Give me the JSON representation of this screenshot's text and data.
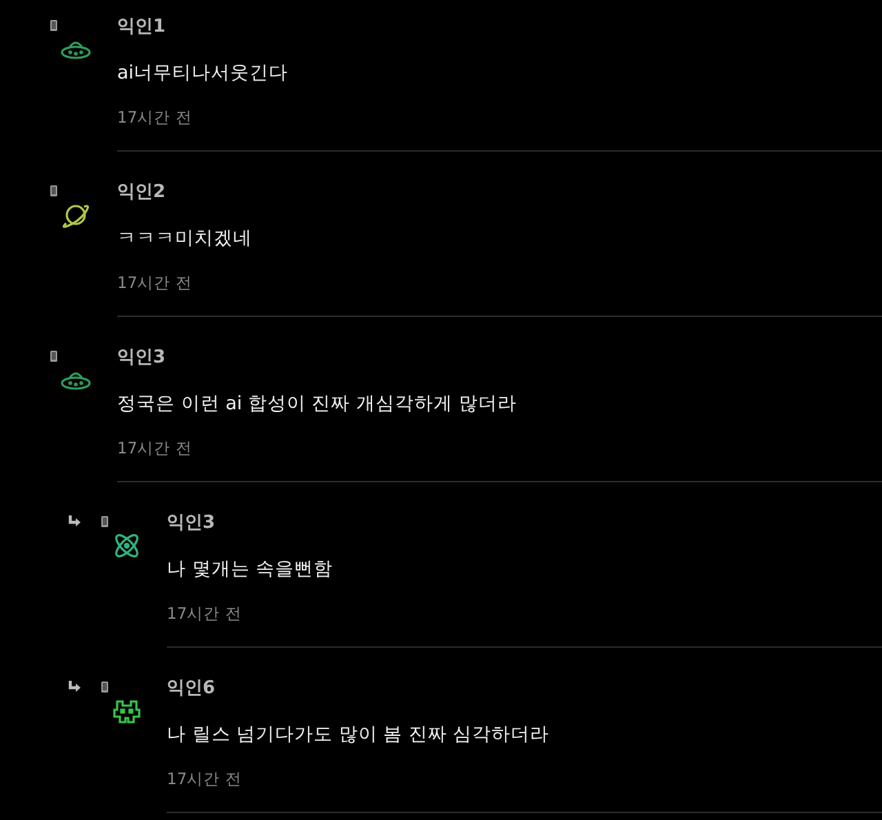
{
  "comments": [
    {
      "author": "익인1",
      "text": "ai너무티나서웃긴다",
      "time": "17시간 전",
      "reply": false,
      "kind": "ufo",
      "color": "#2e9e5c"
    },
    {
      "author": "익인2",
      "text": "ㅋㅋㅋ미치겠네",
      "time": "17시간 전",
      "reply": false,
      "kind": "planet",
      "color": "#b3c64a"
    },
    {
      "author": "익인3",
      "text": "정국은 이런 ai 합성이 진짜 개심각하게 많더라",
      "time": "17시간 전",
      "reply": false,
      "kind": "ufo",
      "color": "#2e9e5c"
    },
    {
      "author": "익인3",
      "text": "나 몇개는 속을뻔함",
      "time": "17시간 전",
      "reply": true,
      "kind": "atom",
      "color": "#2fb480"
    },
    {
      "author": "익인6",
      "text": "나 릴스 넘기다가도 많이 봄 진짜 심각하더라",
      "time": "17시간 전",
      "reply": true,
      "kind": "invader",
      "color": "#35c44a"
    }
  ]
}
